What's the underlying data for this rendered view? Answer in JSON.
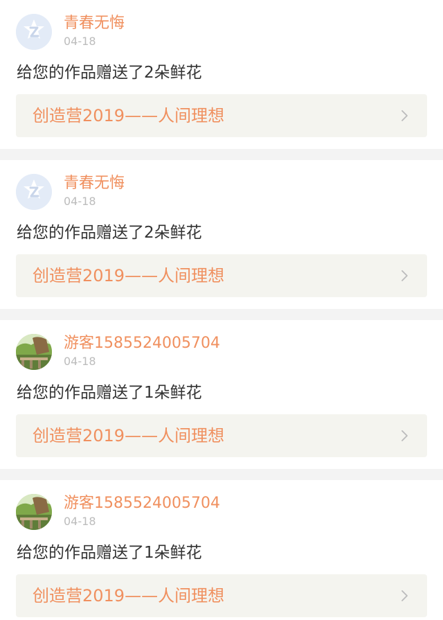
{
  "notifications": [
    {
      "avatar_type": "qq-default",
      "username": "青春无悔",
      "time": "04-18",
      "message": "给您的作品赠送了2朵鲜花",
      "link_title": "创造营2019——人间理想"
    },
    {
      "avatar_type": "qq-default",
      "username": "青春无悔",
      "time": "04-18",
      "message": "给您的作品赠送了2朵鲜花",
      "link_title": "创造营2019——人间理想"
    },
    {
      "avatar_type": "landscape-photo",
      "username": "游客1585524005704",
      "time": "04-18",
      "message": "给您的作品赠送了1朵鲜花",
      "link_title": "创造营2019——人间理想"
    },
    {
      "avatar_type": "landscape-photo",
      "username": "游客1585524005704",
      "time": "04-18",
      "message": "给您的作品赠送了1朵鲜花",
      "link_title": "创造营2019——人间理想"
    }
  ],
  "colors": {
    "background": "#f3f3f3",
    "card": "#ffffff",
    "accent": "#f0905f",
    "text": "#333333",
    "muted": "#bcbcbc",
    "link_box": "#f4f4ef"
  },
  "icons": {
    "chevron": "chevron-right-icon",
    "qq_avatar": "qq-avatar-icon",
    "photo_avatar": "landscape-avatar-icon"
  }
}
